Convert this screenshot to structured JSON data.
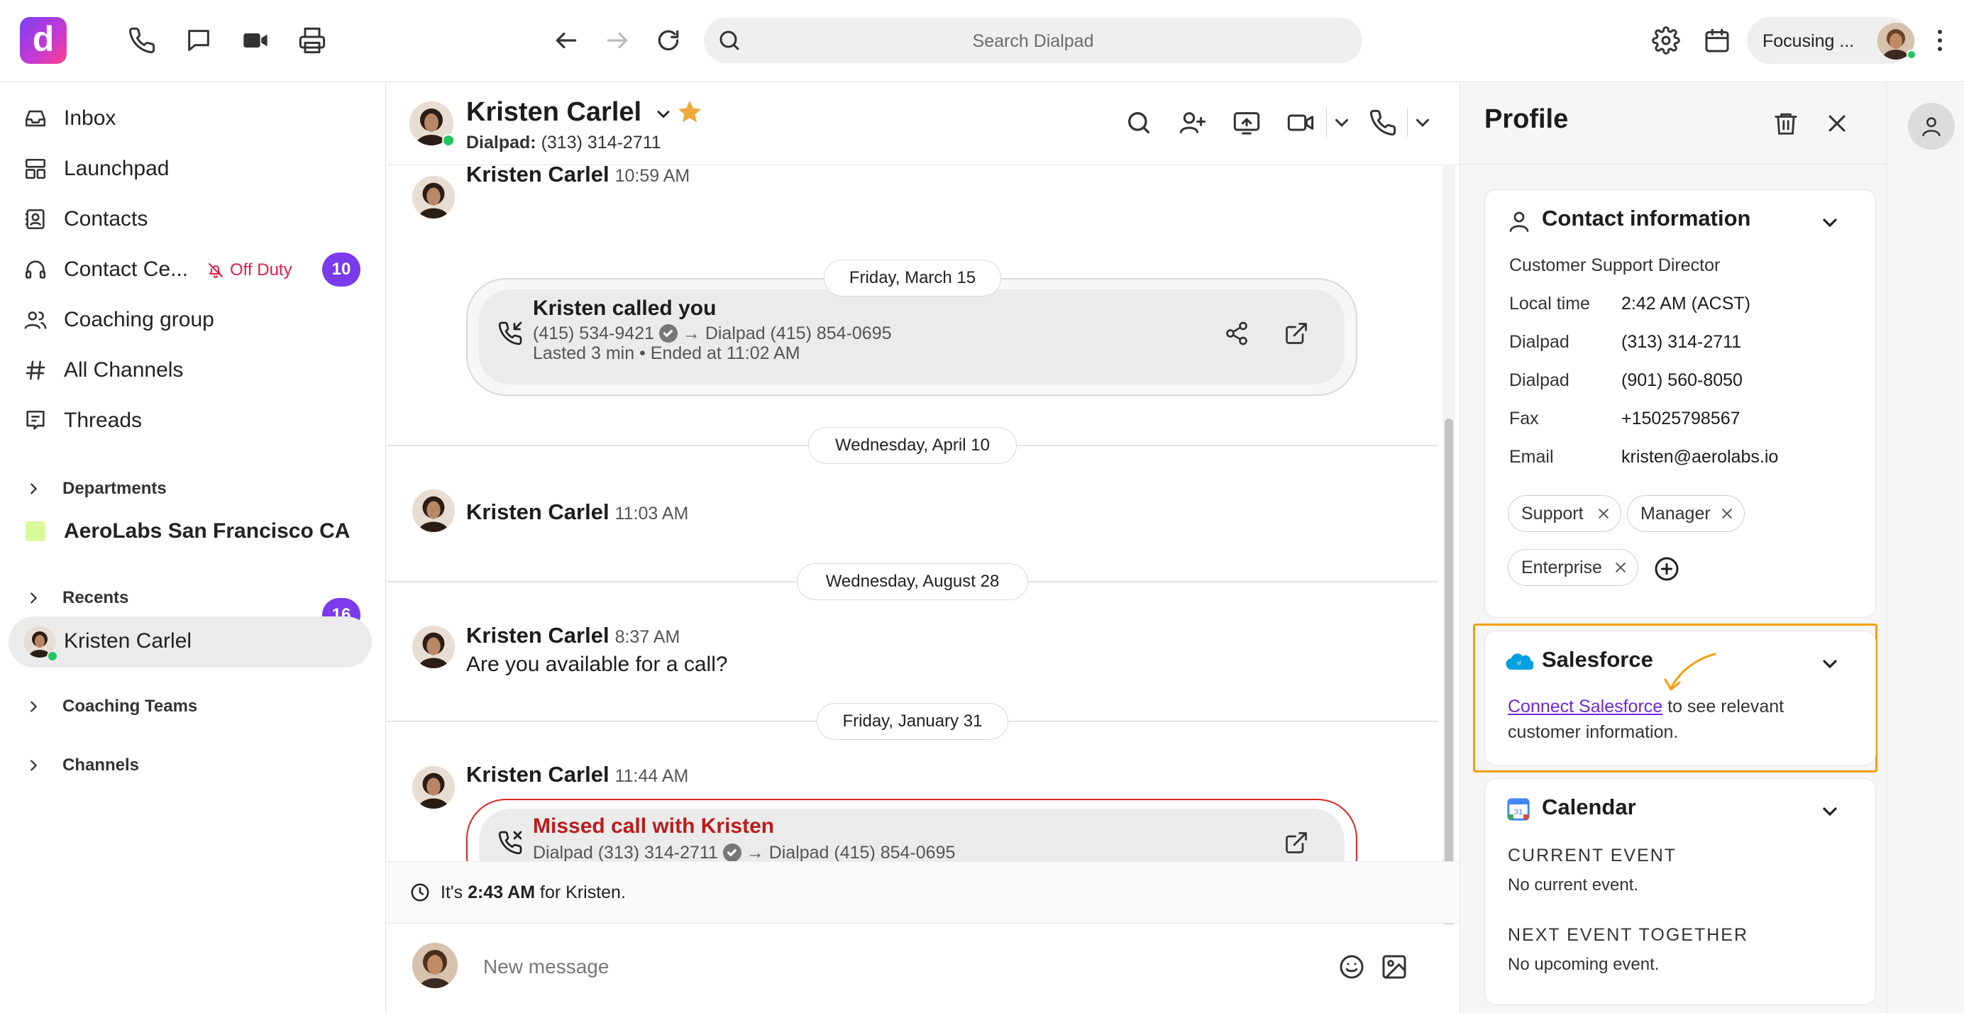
{
  "topbar": {
    "logo_letter": "d",
    "search_placeholder": "Search Dialpad",
    "status_label": "Focusing ..."
  },
  "sidebar": {
    "items": [
      {
        "label": "Inbox",
        "icon": "inbox-icon"
      },
      {
        "label": "Launchpad",
        "icon": "launchpad-icon"
      },
      {
        "label": "Contacts",
        "icon": "contacts-icon"
      },
      {
        "label": "Contact Ce...",
        "icon": "headset-icon",
        "status": "Off Duty",
        "badge": "10"
      },
      {
        "label": "Coaching group",
        "icon": "people-icon"
      },
      {
        "label": "All Channels",
        "icon": "hash-icon"
      },
      {
        "label": "Threads",
        "icon": "threads-icon"
      }
    ],
    "departments_header": "Departments",
    "department": {
      "label": "AeroLabs San Francisco CA",
      "badge": "16",
      "color": "#d9f99d"
    },
    "recents_header": "Recents",
    "recent": {
      "label": "Kristen Carlel"
    },
    "coaching_teams_header": "Coaching Teams",
    "channels_header": "Channels"
  },
  "conversation": {
    "name": "Kristen Carlel",
    "line_label": "Dialpad:",
    "line_number": "(313) 314-2711",
    "messages": [
      {
        "name": "Kristen Carlel",
        "time": "10:59 AM"
      },
      {
        "name": "Kristen Carlel",
        "time": "11:03 AM"
      },
      {
        "name": "Kristen Carlel",
        "time": "8:37 AM",
        "text": "Are you available for a call?"
      },
      {
        "name": "Kristen Carlel",
        "time": "11:44 AM"
      }
    ],
    "dates": [
      "Friday, March 15",
      "Wednesday, April 10",
      "Wednesday, August 28",
      "Friday, January 31"
    ],
    "call1": {
      "title": "Kristen called you",
      "from": "(415) 534-9421",
      "to": "Dialpad (415) 854-0695",
      "meta": "Lasted 3 min • Ended at 11:02 AM"
    },
    "call2": {
      "title": "Missed call with Kristen",
      "from": "Dialpad (313) 314-2711",
      "to": "Dialpad (415) 854-0695"
    },
    "local_time_prefix": "It's",
    "local_time": "2:43 AM",
    "local_time_suffix": "for Kristen.",
    "composer_placeholder": "New message"
  },
  "profile": {
    "title": "Profile",
    "contact_info": {
      "title": "Contact information",
      "job_title": "Customer Support Director",
      "rows": [
        {
          "k": "Local time",
          "v": "2:42 AM (ACST)"
        },
        {
          "k": "Dialpad",
          "v": "(313) 314-2711"
        },
        {
          "k": "Dialpad",
          "v": "(901) 560-8050"
        },
        {
          "k": "Fax",
          "v": "+15025798567"
        },
        {
          "k": "Email",
          "v": "kristen@aerolabs.io"
        }
      ],
      "tags": [
        "Support",
        "Manager",
        "Enterprise"
      ]
    },
    "salesforce": {
      "title": "Salesforce",
      "link": "Connect Salesforce",
      "text_after_link": "to see relevant",
      "text_line2": "customer information."
    },
    "calendar": {
      "title": "Calendar",
      "current_header": "CURRENT EVENT",
      "current_text": "No current event.",
      "next_header": "NEXT EVENT TOGETHER",
      "next_text": "No upcoming event."
    }
  },
  "colors": {
    "accent": "#7c3aed",
    "highlight": "#f59e0b",
    "missed_red": "#b91c1c",
    "off_duty": "#e11d48",
    "link": "#6d28d9"
  }
}
